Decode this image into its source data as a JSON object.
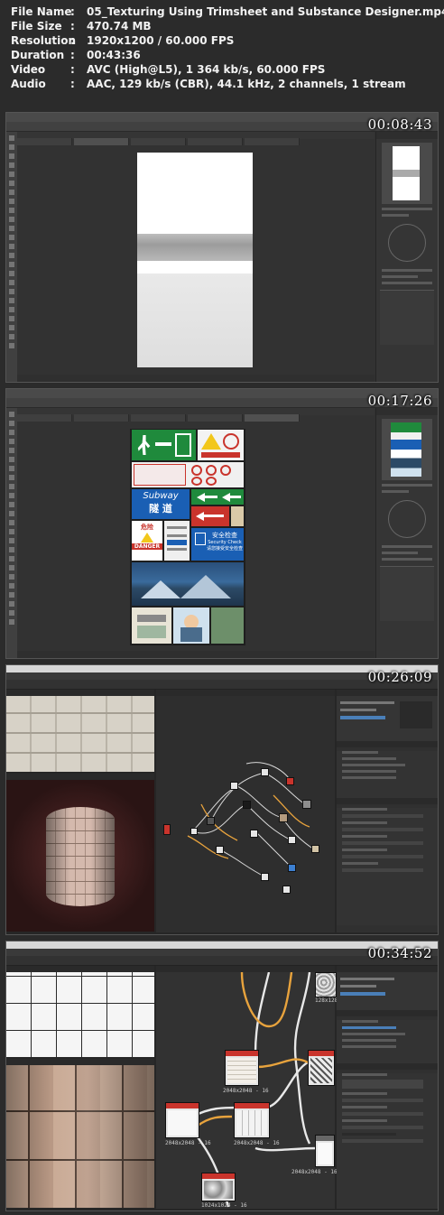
{
  "file_info": {
    "rows": [
      {
        "key": "File Name",
        "value": "05_Texturing Using Trimsheet and Substance Designer.mp4"
      },
      {
        "key": "File Size",
        "value": "470.74 MB"
      },
      {
        "key": "Resolution",
        "value": "1920x1200 / 60.000 FPS"
      },
      {
        "key": "Duration",
        "value": "00:43:36"
      },
      {
        "key": "Video",
        "value": "AVC (High@L5), 1 364 kb/s, 60.000 FPS"
      },
      {
        "key": "Audio",
        "value": "AAC, 129 kb/s (CBR), 44.1 kHz, 2 channels, 1 stream"
      }
    ],
    "separator": ":"
  },
  "thumbnails": [
    {
      "timestamp": "00:08:43",
      "app": "Photoshop"
    },
    {
      "timestamp": "00:17:26",
      "app": "Photoshop",
      "signs": {
        "subway_title": "Subway",
        "subway_cn": "隧 道",
        "danger": "DANGER",
        "danger_cn": "危险",
        "security_cn": "安全检查",
        "security_en": "Security Check",
        "security_cn2": "请您接受安全检查"
      }
    },
    {
      "timestamp": "00:26:09",
      "app": "Substance Designer"
    },
    {
      "timestamp": "00:34:52",
      "app": "Substance Designer",
      "nodes": {
        "res_a": "2048x2048 - 16",
        "res_b": "2048x2048 - 16",
        "res_c": "2048x2048 - 16",
        "res_d": "1024x1024 - 16",
        "res_e": "2048x2048 - 16",
        "res_top": "128x128 - 16"
      }
    }
  ],
  "colors": {
    "bg": "#2b2b2b",
    "text": "#f2f2f2",
    "ps_dark": "#323232",
    "sd_graph": "#2e2e2e",
    "wire_orange": "#e8a33d",
    "node_red": "#c9342c",
    "sign_green": "#1f8a3c",
    "sign_blue": "#1a5fb4",
    "sign_yellow": "#f2c71b"
  }
}
